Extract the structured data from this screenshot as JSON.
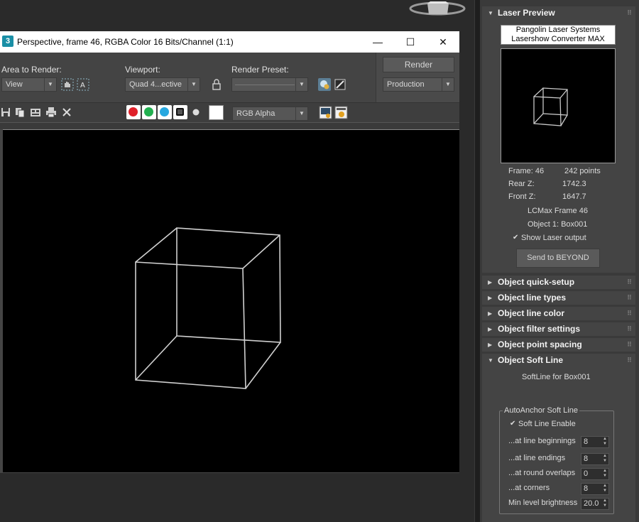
{
  "window": {
    "title": "Perspective, frame 46, RGBA Color 16 Bits/Channel (1:1)",
    "minimize": "—",
    "maximize": "☐",
    "close": "✕",
    "area_to_render_label": "Area to Render:",
    "area_to_render_value": "View",
    "viewport_label": "Viewport:",
    "viewport_value": "Quad 4...ective",
    "render_preset_label": "Render Preset:",
    "render_preset_value": "",
    "render_button": "Render",
    "production_value": "Production",
    "channel_display_value": "RGB Alpha"
  },
  "panel": {
    "laser_preview_title": "Laser Preview",
    "company_line1": "Pangolin Laser Systems",
    "company_line2": "Lasershow Converter MAX",
    "frame_label": "Frame: 46",
    "points_label": "242 points",
    "rear_z_label": "Rear  Z:",
    "rear_z_value": "1742.3",
    "front_z_label": "Front Z:",
    "front_z_value": "1647.7",
    "lcmax_frame": "LCMax Frame 46",
    "object_label": "Object 1: Box001",
    "show_laser_output": "Show Laser output",
    "send_button": "Send to BEYOND",
    "rollouts": [
      "Object quick-setup",
      "Object line types",
      "Object line color",
      "Object filter settings",
      "Object point spacing"
    ],
    "soft_line_title": "Object Soft Line",
    "softline_for": "SoftLine for Box001",
    "group_title": "AutoAnchor Soft Line",
    "soft_line_enable": "Soft Line Enable",
    "rows": [
      {
        "label": "...at line beginnings",
        "value": "8"
      },
      {
        "label": "...at line endings",
        "value": "8"
      },
      {
        "label": "...at round overlaps",
        "value": "0"
      },
      {
        "label": "...at corners",
        "value": "8"
      },
      {
        "label": "Min level brightness",
        "value": "20.0"
      }
    ]
  },
  "colors": {
    "accent": "#1a8fa6",
    "panel_bg": "#444444",
    "viewport_bg": "#000000"
  }
}
